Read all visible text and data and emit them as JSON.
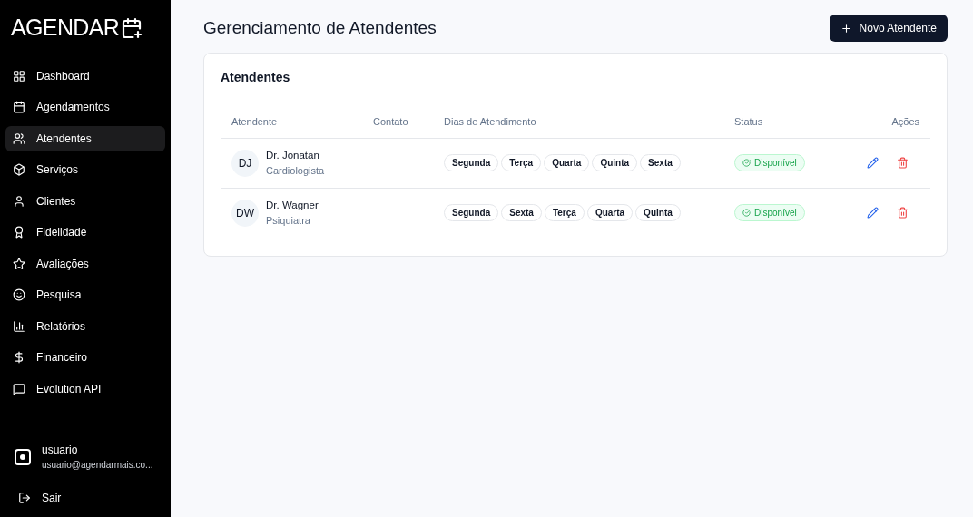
{
  "sidebar": {
    "logo": "AGENDAR",
    "items": [
      {
        "label": "Dashboard",
        "selected": false
      },
      {
        "label": "Agendamentos",
        "selected": false
      },
      {
        "label": "Atendentes",
        "selected": true
      },
      {
        "label": "Serviços",
        "selected": false
      },
      {
        "label": "Clientes",
        "selected": false
      },
      {
        "label": "Fidelidade",
        "selected": false
      },
      {
        "label": "Avaliações",
        "selected": false
      },
      {
        "label": "Pesquisa",
        "selected": false
      },
      {
        "label": "Relatórios",
        "selected": false
      },
      {
        "label": "Financeiro",
        "selected": false
      },
      {
        "label": "Evolution API",
        "selected": false
      }
    ],
    "user": {
      "name": "usuario",
      "email": "usuario@agendarmais.co..."
    },
    "logout": "Sair"
  },
  "header": {
    "title": "Gerenciamento de Atendentes",
    "button": "Novo Atendente"
  },
  "card": {
    "title": "Atendentes",
    "columns": [
      "Atendente",
      "Contato",
      "Dias de Atendimento",
      "Status",
      "Ações"
    ],
    "rows": [
      {
        "initials": "DJ",
        "name": "Dr. Jonatan",
        "specialty": "Cardiologista",
        "days": [
          "Segunda",
          "Terça",
          "Quarta",
          "Quinta",
          "Sexta"
        ],
        "status": {
          "label": "Disponível",
          "kind": "available"
        }
      },
      {
        "initials": "DW",
        "name": "Dr. Wagner",
        "specialty": "Psiquiatra",
        "days": [
          "Segunda",
          "Sexta",
          "Terça",
          "Quarta",
          "Quinta"
        ],
        "status": {
          "label": "Disponível",
          "kind": "available"
        }
      }
    ]
  }
}
